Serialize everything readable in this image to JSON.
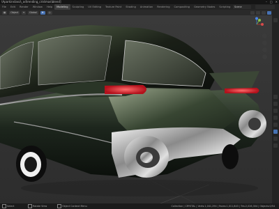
{
  "window": {
    "title": "\\Aparkinstanz\\_od\\rending_cristmas\\blend]"
  },
  "workspaces": [
    "File",
    "Edit",
    "Render",
    "Window",
    "Help",
    "Modeling",
    "Sculpting",
    "UV Editing",
    "Texture Paint",
    "Shading",
    "Animation",
    "Rendering",
    "Compositing",
    "Geometry Nodes",
    "Scripting"
  ],
  "active_workspace": "Modeling",
  "scene": {
    "label": "Scene"
  },
  "header": {
    "object_mode": "Object",
    "global": "Global"
  },
  "status": {
    "left": "Select",
    "middle": "Rotate View",
    "center": "Object Context Menu",
    "right": "Collection | CRYSTAL | Verts:1,041,294 | Faces:1,011,843 | Tris:2,026,304 | Objects:0/54"
  },
  "colors": {
    "accent": "#4772b3",
    "car_body": "#1c261d",
    "chrome": "#cfcfcf",
    "tail_light": "#d81e2a"
  },
  "icons": [
    "close-icon",
    "minimize-icon",
    "maximize-icon",
    "gizmo-x-icon",
    "gizmo-y-icon",
    "gizmo-z-icon",
    "zoom-icon",
    "hand-icon",
    "camera-icon",
    "grid-icon"
  ]
}
